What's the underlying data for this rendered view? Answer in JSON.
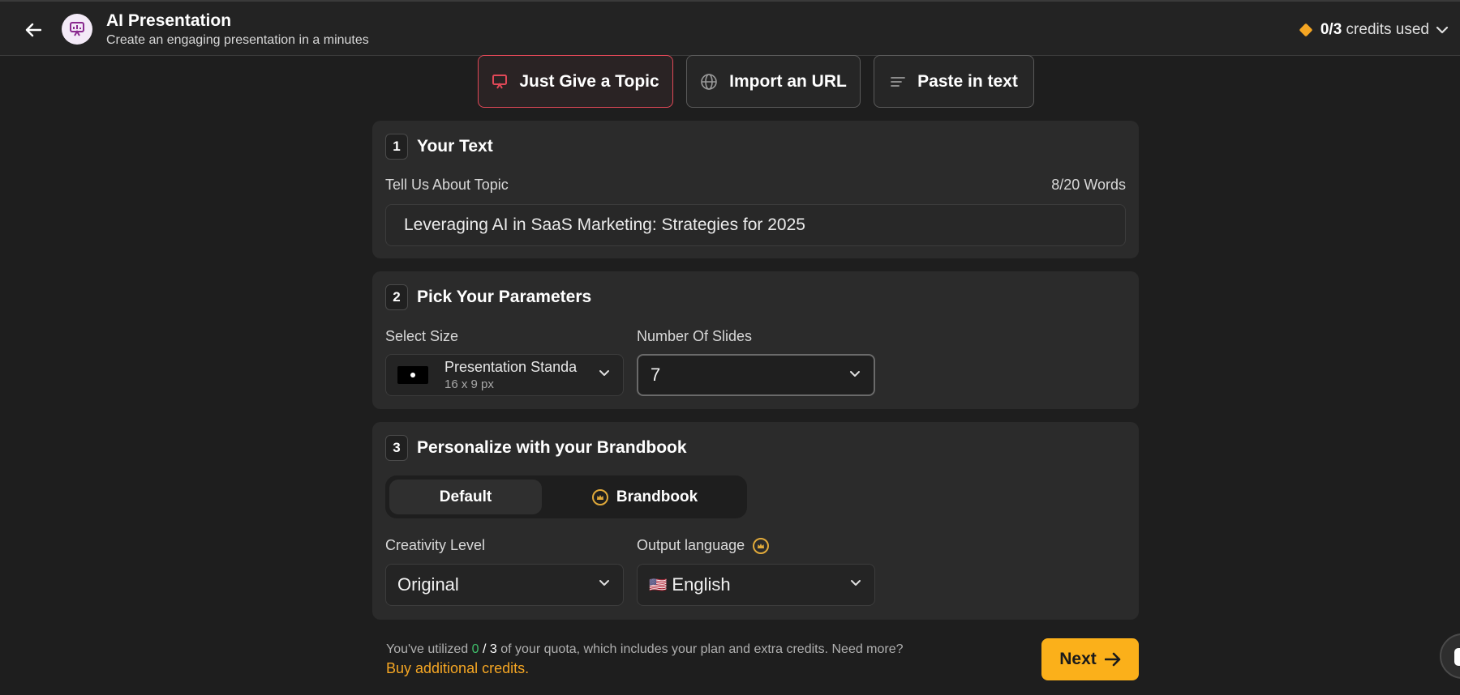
{
  "header": {
    "title": "AI Presentation",
    "subtitle": "Create an engaging presentation in a minutes",
    "credits_count": "0/3",
    "credits_label": "credits used"
  },
  "modes": [
    {
      "label": "Just Give a Topic",
      "icon": "presentation-icon",
      "active": true
    },
    {
      "label": "Import an URL",
      "icon": "globe-icon",
      "active": false
    },
    {
      "label": "Paste in text",
      "icon": "text-lines-icon",
      "active": false
    }
  ],
  "step1": {
    "number": "1",
    "title": "Your Text",
    "topic_label": "Tell Us About Topic",
    "word_count": "8/20 Words",
    "topic_value": "Leveraging AI in SaaS Marketing: Strategies for 2025"
  },
  "step2": {
    "number": "2",
    "title": "Pick Your Parameters",
    "size_label": "Select Size",
    "size_name": "Presentation Standa",
    "size_dims": "16 x 9 px",
    "slides_label": "Number Of Slides",
    "slides_value": "7"
  },
  "step3": {
    "number": "3",
    "title": "Personalize with your Brandbook",
    "seg_default": "Default",
    "seg_brandbook": "Brandbook",
    "creativity_label": "Creativity Level",
    "creativity_value": "Original",
    "language_label": "Output language",
    "language_flag": "🇺🇸",
    "language_value": "English"
  },
  "footer": {
    "quota_prefix": "You've utilized ",
    "quota_used": "0",
    "quota_sep": " / ",
    "quota_total": "3",
    "quota_suffix": " of your quota, which includes your plan and extra credits. Need more?",
    "buy_link": "Buy additional credits.",
    "next_label": "Next"
  },
  "colors": {
    "accent_yellow": "#fbb01a",
    "active_tab_border": "#e04857",
    "quota_green": "#3fbf6a"
  }
}
